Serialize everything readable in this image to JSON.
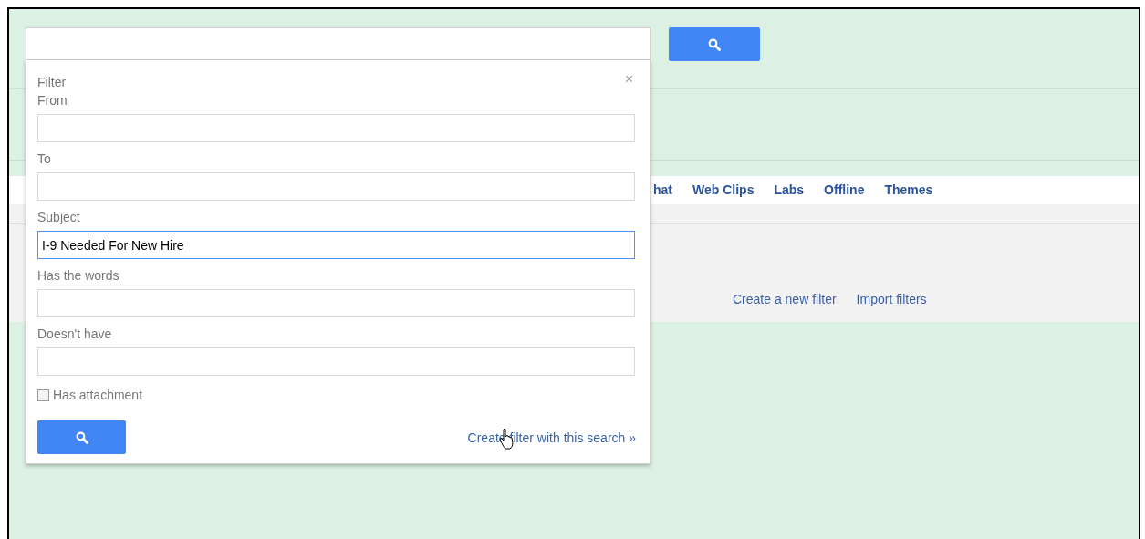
{
  "tabs": [
    {
      "label": "hat"
    },
    {
      "label": "Web Clips"
    },
    {
      "label": "Labs"
    },
    {
      "label": "Offline"
    },
    {
      "label": "Themes"
    }
  ],
  "filter_links": [
    {
      "label": "Create a new filter"
    },
    {
      "label": "Import filters"
    }
  ],
  "filter_panel": {
    "title": "Filter",
    "close": "×",
    "fields": [
      {
        "label": "From",
        "focused": false
      },
      {
        "label": "To",
        "focused": false
      },
      {
        "label": "Subject",
        "value": "I-9 Needed For New Hire",
        "focused": true
      },
      {
        "label": "Has the words",
        "focused": false
      },
      {
        "label": "Doesn't have",
        "focused": false
      }
    ],
    "has_attachment": {
      "label": "Has attachment",
      "checked": false
    },
    "create_link": "Create filter with this search »"
  }
}
